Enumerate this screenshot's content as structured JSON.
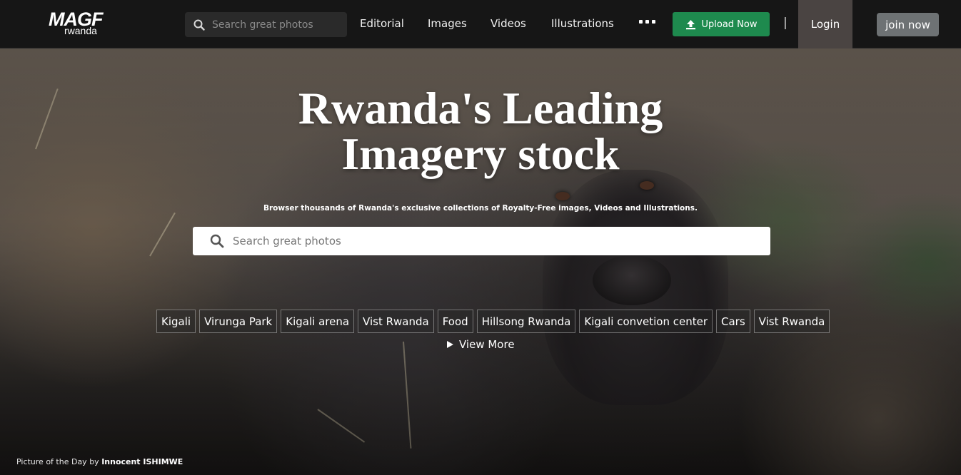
{
  "nav": {
    "logo_text": "MAGF",
    "logo_sub": "rwanda",
    "search_placeholder": "Search great photos",
    "links": [
      "Editorial",
      "Images",
      "Videos",
      "Illustrations"
    ],
    "more_icon": "ellipsis-icon",
    "upload_label": "Upload Now",
    "separator": "|",
    "login_label": "Login",
    "join_label": "join now"
  },
  "hero": {
    "title_line1": "Rwanda's Leading",
    "title_line2": "Imagery stock",
    "subtitle": "Browser thousands of Rwanda's exclusive collections of Royalty-Free images, Videos and Illustrations.",
    "search_placeholder": "Search great photos",
    "tags": [
      "Kigali",
      "Virunga Park",
      "Kigali arena",
      "Vist Rwanda",
      "Food",
      "Hillsong Rwanda",
      "Kigali convetion center",
      "Cars",
      "Vist Rwanda"
    ],
    "view_more_label": "View More",
    "credit_prefix": "Picture of the Day by",
    "credit_author": "Innocent ISHIMWE"
  },
  "colors": {
    "nav_bg": "#161616",
    "upload_green": "#1e8a4e",
    "login_bg": "#4a4442",
    "join_bg": "#6e7274"
  }
}
